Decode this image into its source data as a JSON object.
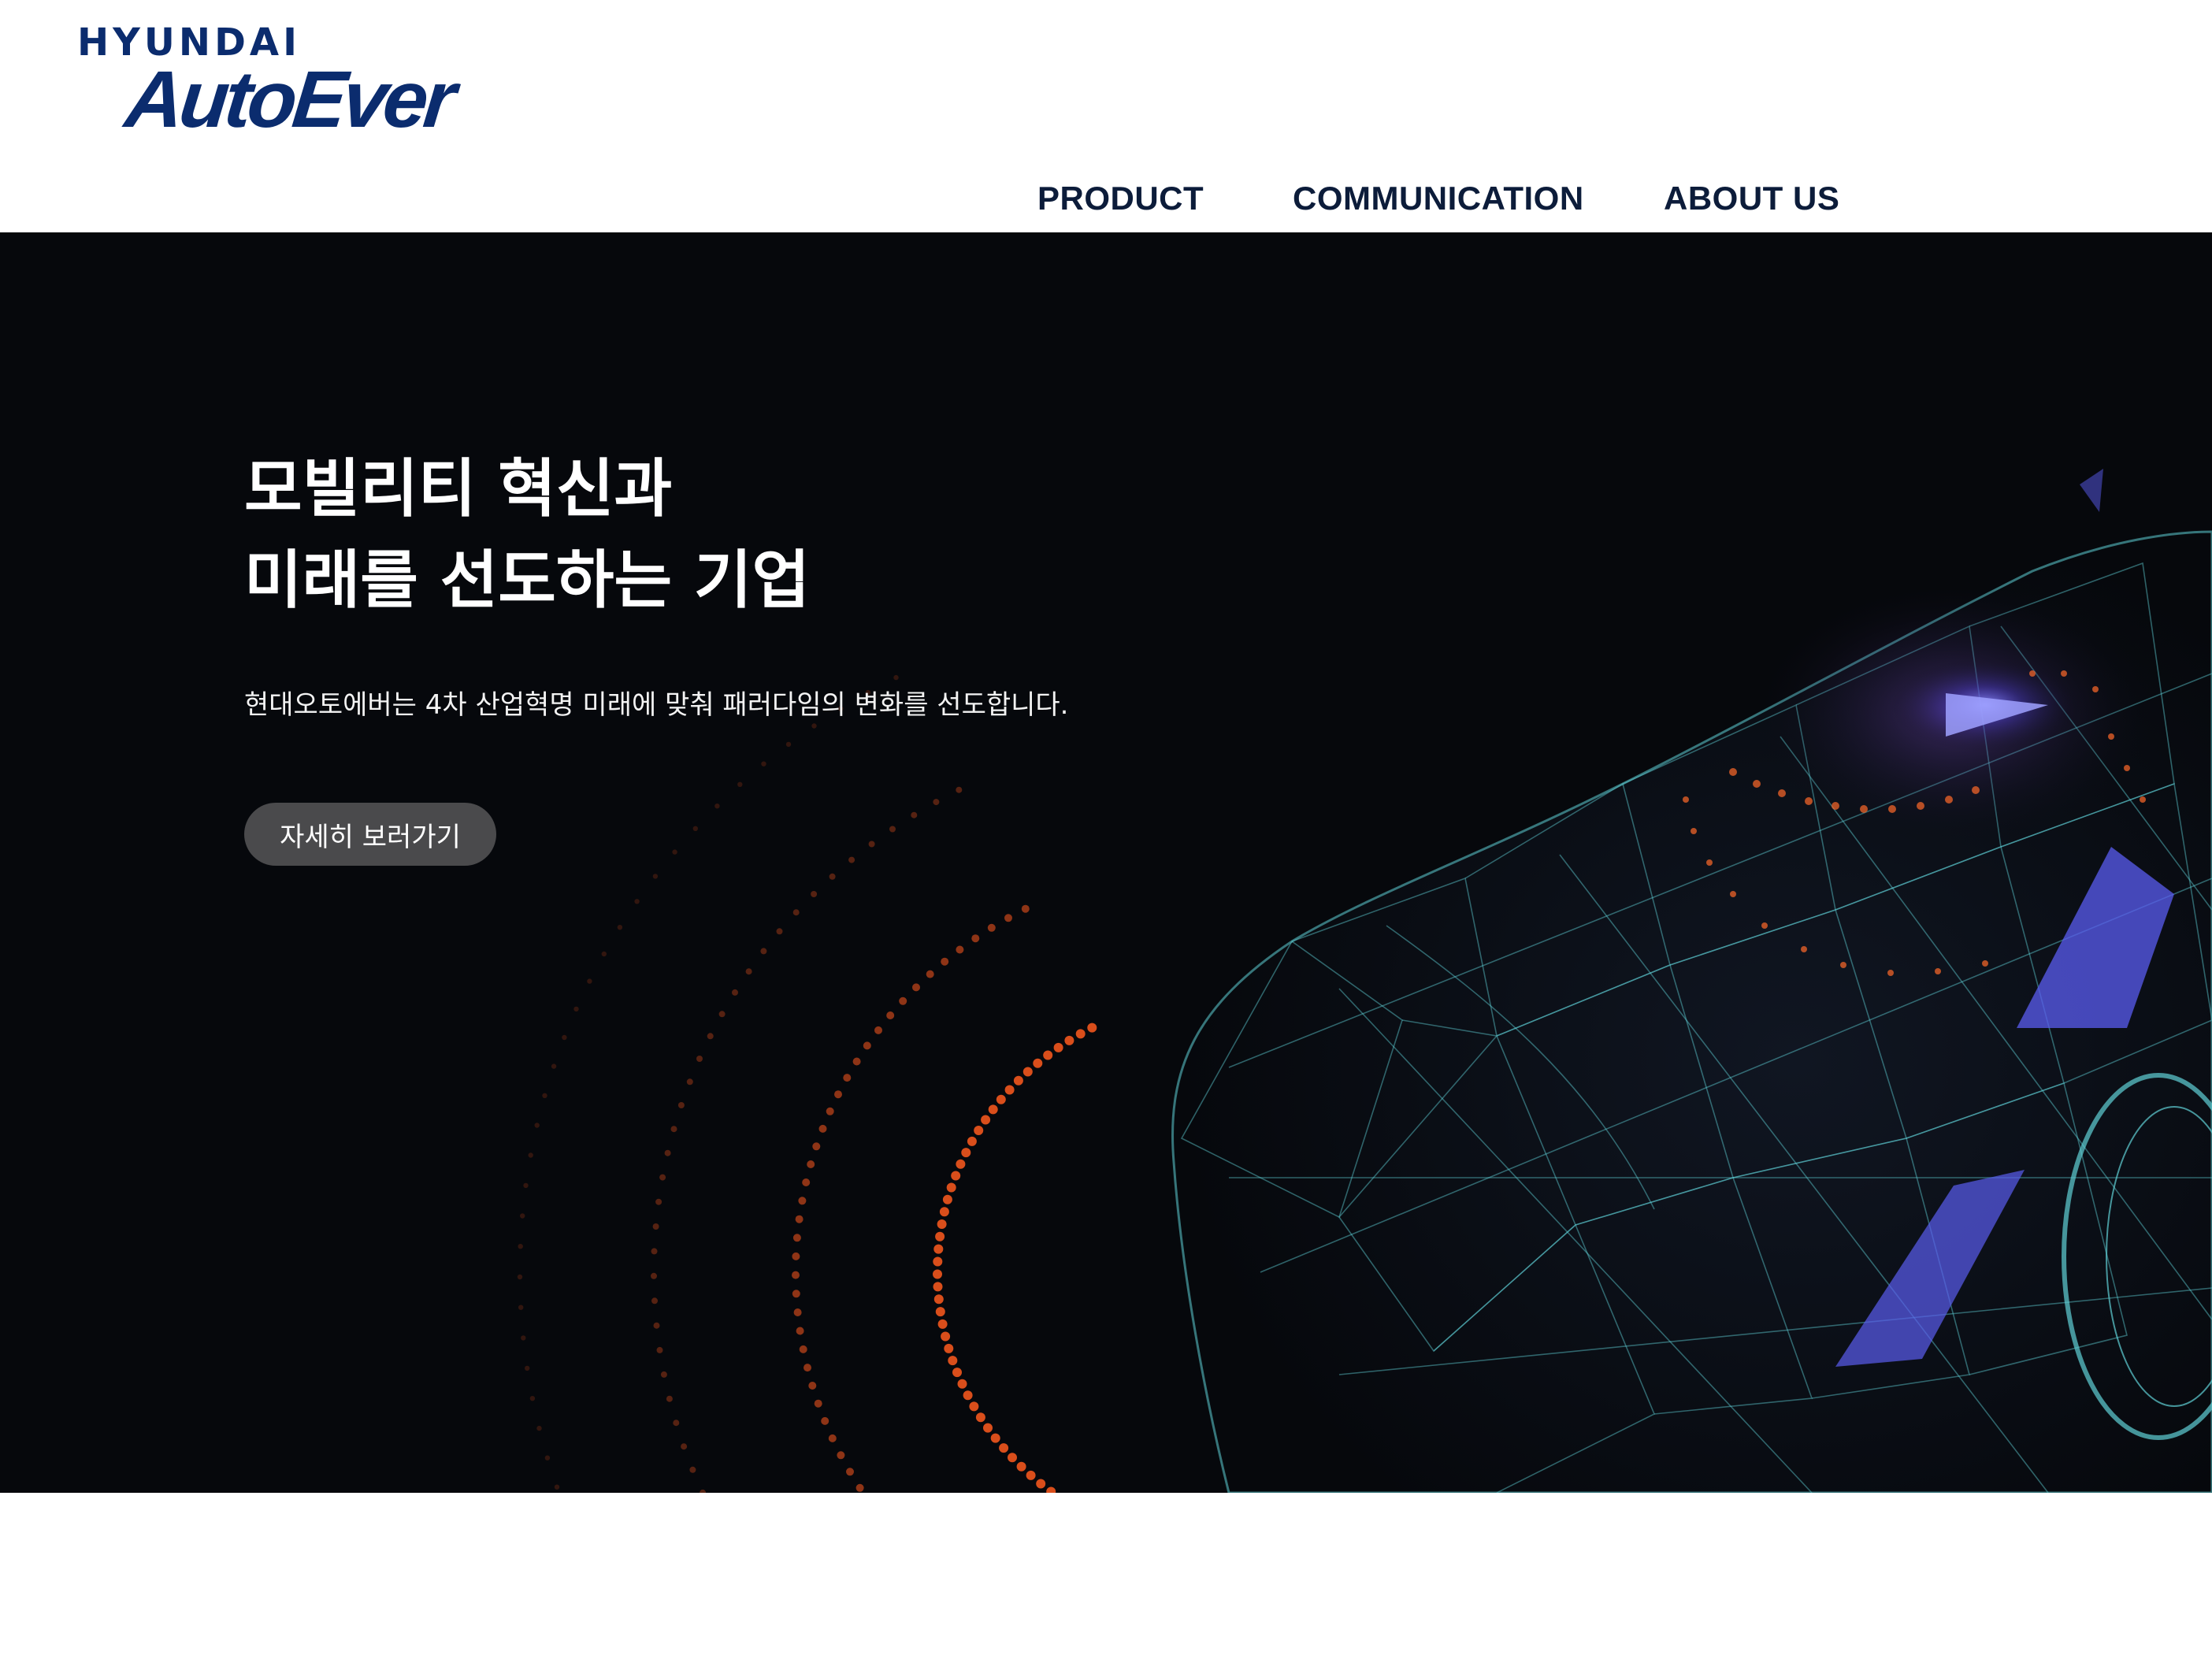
{
  "brand": {
    "logo_top": "HYUNDAI",
    "logo_main": "AutoEver",
    "color": "#0b2c6e"
  },
  "nav": {
    "items": [
      {
        "label": "PRODUCT"
      },
      {
        "label": "COMMUNICATION"
      },
      {
        "label": "ABOUT US"
      }
    ]
  },
  "hero": {
    "title_line1": "모빌리티 혁신과",
    "title_line2": "미래를 선도하는 기업",
    "subtitle": "현대오토에버는 4차 산업혁명 미래에 맞춰 패러다임의 변화를 선도합니다.",
    "cta_label": "자세히 보러가기",
    "background_color": "#06080c",
    "accent_colors": {
      "wireframe": "#5fd0d6",
      "glow_blue": "#5a5cf0",
      "dots_orange": "#ff5a1f"
    },
    "illustration": "wireframe-car-image"
  }
}
